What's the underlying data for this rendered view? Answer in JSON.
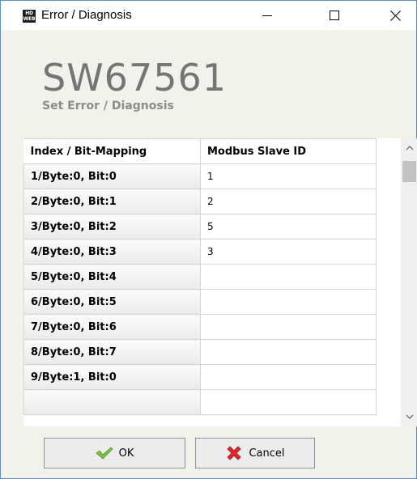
{
  "window": {
    "title": "Error / Diagnosis",
    "icon_label": "HD WEB",
    "icon_name": "app-logo-icon"
  },
  "header": {
    "brand": "SW67561",
    "subtitle": "Set Error / Diagnosis"
  },
  "grid": {
    "columns": [
      "Index / Bit-Mapping",
      "Modbus Slave ID"
    ],
    "rows": [
      {
        "index": "1/Byte:0, Bit:0",
        "value": "1"
      },
      {
        "index": "2/Byte:0, Bit:1",
        "value": "2"
      },
      {
        "index": "3/Byte:0, Bit:2",
        "value": "5"
      },
      {
        "index": "4/Byte:0, Bit:3",
        "value": "3"
      },
      {
        "index": "5/Byte:0, Bit:4",
        "value": ""
      },
      {
        "index": "6/Byte:0, Bit:5",
        "value": ""
      },
      {
        "index": "7/Byte:0, Bit:6",
        "value": ""
      },
      {
        "index": "8/Byte:0, Bit:7",
        "value": ""
      },
      {
        "index": "9/Byte:1, Bit:0",
        "value": ""
      },
      {
        "index": "",
        "value": ""
      }
    ]
  },
  "footer": {
    "ok_label": "OK",
    "cancel_label": "Cancel"
  },
  "colors": {
    "window_border": "#5b8dc8",
    "panel_bg": "#f2f2ea",
    "brand_text": "#757575",
    "ok_check": "#7ac143",
    "cancel_x": "#e0282f"
  }
}
